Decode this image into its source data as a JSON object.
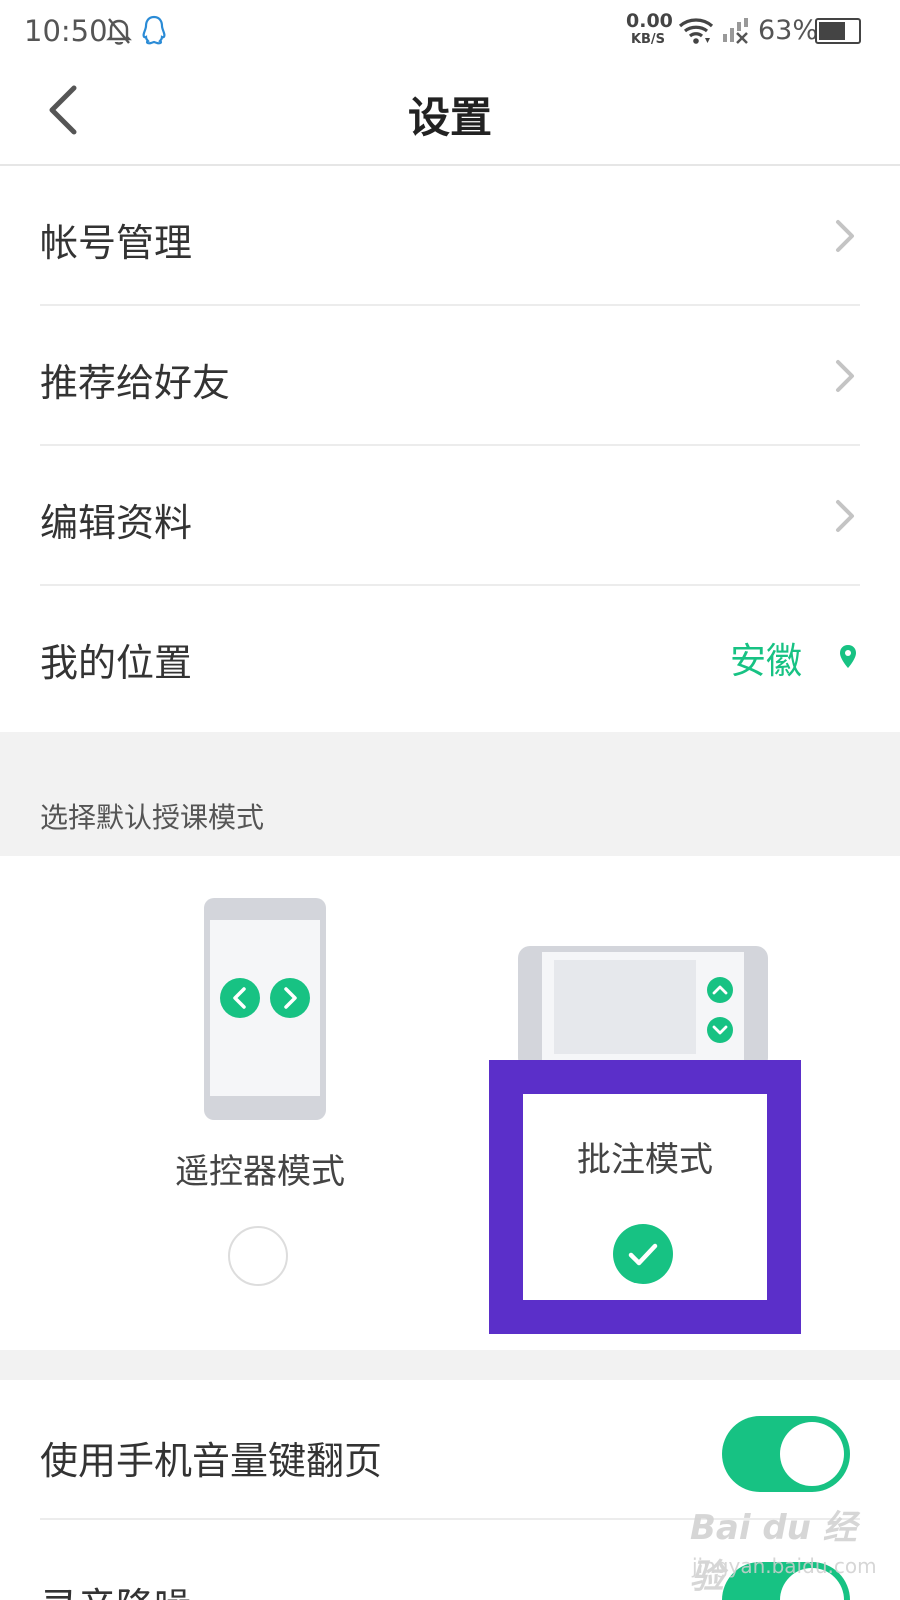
{
  "status_bar": {
    "time": "10:50",
    "net_speed_value": "0.00",
    "net_speed_unit": "KB/S",
    "battery_percent": "63%",
    "battery_level": 0.63,
    "icons": [
      "bell-off-icon",
      "qq-icon",
      "wifi-icon",
      "signal-off-icon",
      "battery-icon"
    ]
  },
  "nav": {
    "title": "设置",
    "back_icon": "chevron-left-icon"
  },
  "settings_list": [
    {
      "label": "帐号管理",
      "icon": "chevron-right-icon"
    },
    {
      "label": "推荐给好友",
      "icon": "chevron-right-icon"
    },
    {
      "label": "编辑资料",
      "icon": "chevron-right-icon"
    },
    {
      "label": "我的位置",
      "value": "安徽",
      "icon": "location-pin-icon"
    }
  ],
  "mode_section": {
    "title": "选择默认授课模式",
    "options": [
      {
        "label": "遥控器模式",
        "selected": false,
        "illustration": "phone-remote-icon"
      },
      {
        "label": "批注模式",
        "selected": true,
        "illustration": "tablet-annotation-icon"
      }
    ]
  },
  "toggles": [
    {
      "label": "使用手机音量键翻页",
      "on": true
    },
    {
      "label": "录音降噪",
      "on": true
    }
  ],
  "colors": {
    "accent": "#17c283",
    "highlight": "#5b2fc9",
    "section_background": "#f2f2f2"
  },
  "watermark": {
    "main": "Bai du 经验",
    "sub": "jingyan.baidu.com"
  }
}
